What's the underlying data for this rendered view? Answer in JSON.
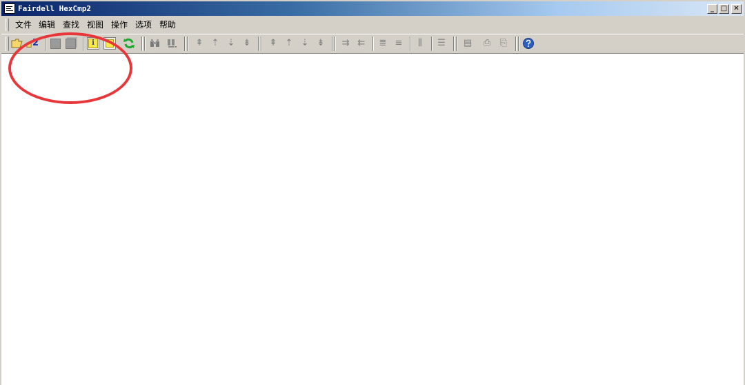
{
  "window": {
    "title": "Fairdell HexCmp2",
    "controls": {
      "minimize": "_",
      "maximize": "□",
      "close": "✕"
    }
  },
  "menubar": {
    "items": [
      "文件",
      "编辑",
      "查找",
      "视图",
      "操作",
      "选项",
      "帮助"
    ]
  },
  "toolbar": {
    "open_file2_badge": "2",
    "info_glyph": "i"
  },
  "colors": {
    "title_start": "#0a246a",
    "title_end": "#a6caf0",
    "annotation_circle": "#e8373b",
    "refresh_green": "#1fa82e",
    "help_blue": "#2b5fbf"
  }
}
